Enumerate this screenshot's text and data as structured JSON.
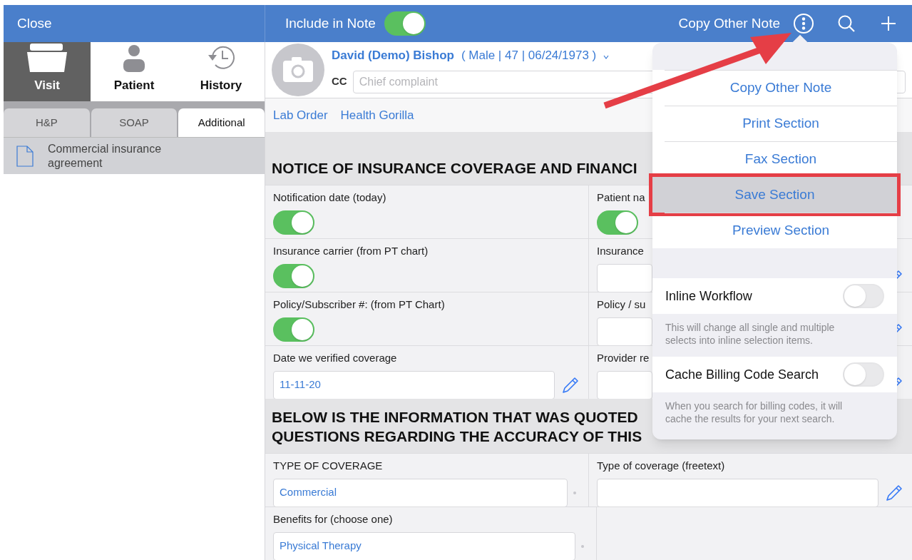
{
  "top_bar": {
    "close": "Close",
    "include_label": "Include in Note",
    "include_on": true,
    "copy_other_note": "Copy Other Note"
  },
  "nav_tabs": [
    {
      "label": "Visit",
      "selected": true,
      "kind": "folder"
    },
    {
      "label": "Patient",
      "selected": false,
      "kind": "person"
    },
    {
      "label": "History",
      "selected": false,
      "kind": "history"
    }
  ],
  "segments": [
    {
      "label": "H&P",
      "selected": false
    },
    {
      "label": "SOAP",
      "selected": false
    },
    {
      "label": "Additional",
      "selected": true
    }
  ],
  "documents": [
    {
      "title": "Commercial insurance agreement",
      "selected": true
    }
  ],
  "patient": {
    "name": "David (Demo) Bishop",
    "details": "( Male | 47 | 06/24/1973 )",
    "cc_label": "CC",
    "cc_placeholder": "Chief complaint"
  },
  "links": [
    "Lab Order",
    "Health Gorilla"
  ],
  "sections": [
    {
      "heading": [
        "NOTICE OF INSURANCE COVERAGE AND FINANCI"
      ],
      "rows": [
        {
          "left": {
            "kind": "toggle",
            "label": "Notification date (today)",
            "on": true
          },
          "right": {
            "kind": "toggle",
            "label": "Patient na",
            "on": true
          }
        },
        {
          "left": {
            "kind": "toggle",
            "label": "Insurance carrier (from PT chart)",
            "on": true
          },
          "right": {
            "kind": "text",
            "label": "Insurance"
          }
        },
        {
          "left": {
            "kind": "toggle",
            "label": "Policy/Subscriber #: (from PT Chart)",
            "on": true
          },
          "right": {
            "kind": "text",
            "label": "Policy / su"
          }
        },
        {
          "left": {
            "kind": "text",
            "label": "Date we verified coverage",
            "value": "11-11-20"
          },
          "right": {
            "kind": "text",
            "label": "Provider re"
          }
        }
      ]
    },
    {
      "heading": [
        "BELOW IS THE INFORMATION THAT WAS QUOTED",
        "QUESTIONS REGARDING THE ACCURACY OF THIS"
      ],
      "rows": [
        {
          "left": {
            "kind": "select",
            "label": "TYPE OF COVERAGE",
            "value": "Commercial"
          },
          "right": {
            "kind": "text",
            "label": "Type of coverage (freetext)"
          }
        },
        {
          "left": {
            "kind": "select",
            "label": "Benefits for (choose one)",
            "value": "Physical Therapy"
          }
        }
      ]
    }
  ],
  "menu": {
    "items": [
      {
        "label": "Copy Other Note",
        "selected": false
      },
      {
        "label": "Print Section",
        "selected": false
      },
      {
        "label": "Fax Section",
        "selected": false
      },
      {
        "label": "Save Section",
        "selected": true
      },
      {
        "label": "Preview Section",
        "selected": false
      }
    ],
    "settings": [
      {
        "label": "Inline Workflow",
        "on": false,
        "note": "This will change all single and multiple selects into inline selection items."
      },
      {
        "label": "Cache Billing Code Search",
        "on": false,
        "note": "When you search for billing codes, it will cache the results for your next search."
      }
    ]
  }
}
